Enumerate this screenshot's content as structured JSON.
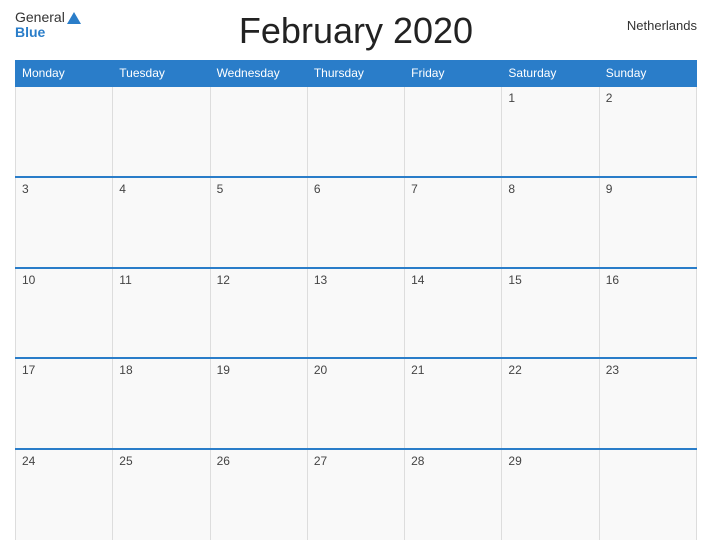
{
  "header": {
    "title": "February 2020",
    "country": "Netherlands",
    "logo_general": "General",
    "logo_blue": "Blue"
  },
  "weekdays": [
    "Monday",
    "Tuesday",
    "Wednesday",
    "Thursday",
    "Friday",
    "Saturday",
    "Sunday"
  ],
  "weeks": [
    [
      "",
      "",
      "",
      "",
      "",
      "1",
      "2"
    ],
    [
      "3",
      "4",
      "5",
      "6",
      "7",
      "8",
      "9"
    ],
    [
      "10",
      "11",
      "12",
      "13",
      "14",
      "15",
      "16"
    ],
    [
      "17",
      "18",
      "19",
      "20",
      "21",
      "22",
      "23"
    ],
    [
      "24",
      "25",
      "26",
      "27",
      "28",
      "29",
      ""
    ]
  ]
}
